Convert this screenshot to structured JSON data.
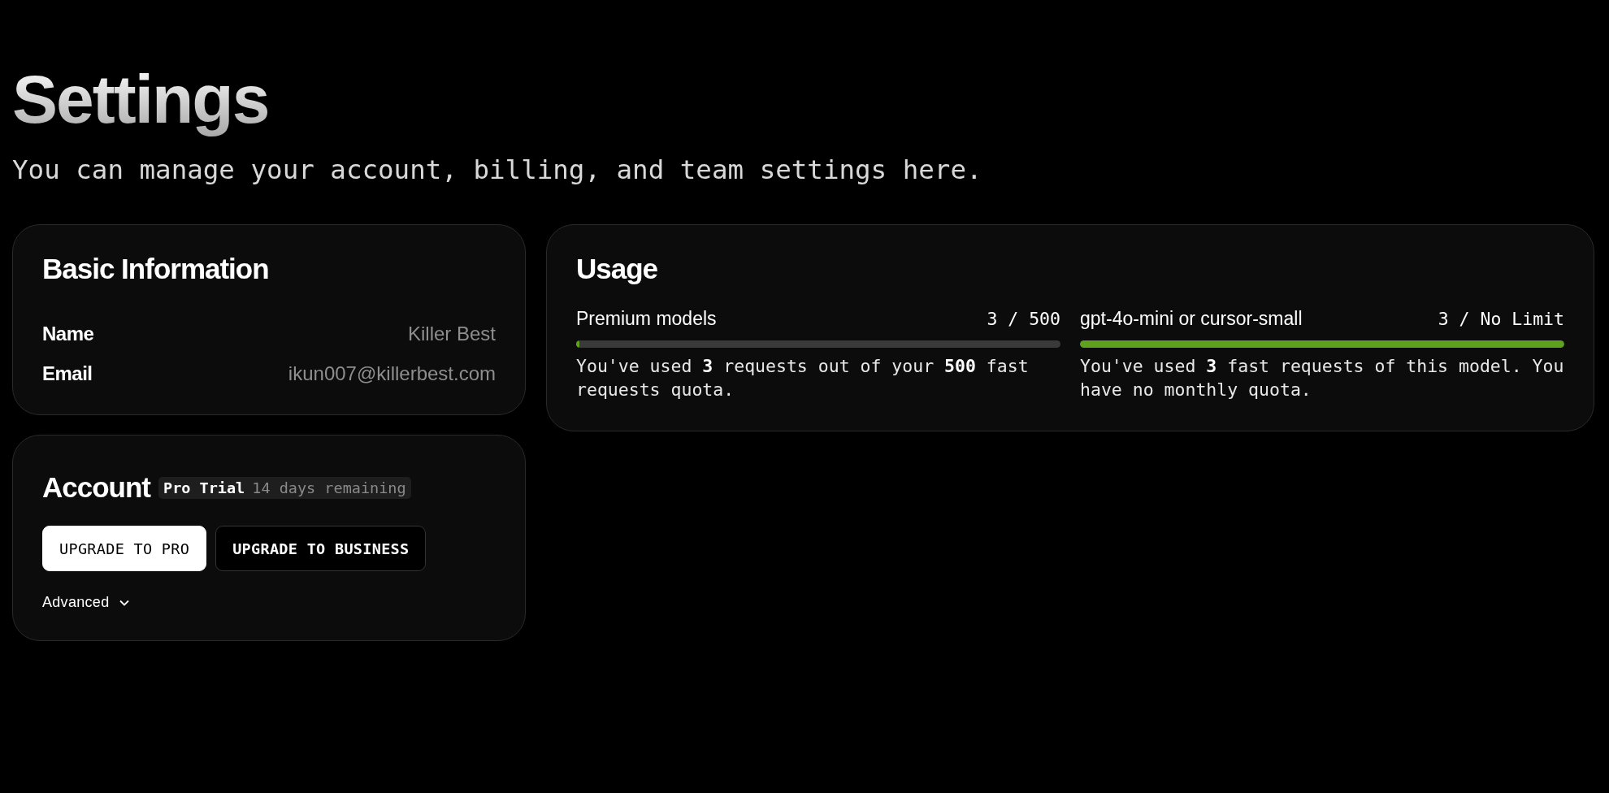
{
  "page": {
    "title": "Settings",
    "subtitle": "You can manage your account, billing, and team settings here."
  },
  "basic_information": {
    "title": "Basic Information",
    "rows": [
      {
        "label": "Name",
        "value": "Killer Best"
      },
      {
        "label": "Email",
        "value": "ikun007@killerbest.com"
      }
    ]
  },
  "account": {
    "title": "Account",
    "badge": {
      "plan": "Pro Trial",
      "detail": "14 days remaining"
    },
    "buttons": [
      {
        "label": "UPGRADE TO PRO",
        "kind": "primary"
      },
      {
        "label": "UPGRADE TO BUSINESS",
        "kind": "secondary"
      }
    ],
    "advanced": {
      "label": "Advanced",
      "expanded": false
    }
  },
  "usage": {
    "title": "Usage",
    "meters": [
      {
        "label": "Premium models",
        "reading": "3 / 500",
        "level": 0.006,
        "description": "You've used **3** requests out of your **500** fast requests quota."
      },
      {
        "label": "gpt-4o-mini or cursor-small",
        "reading": "3 / No Limit",
        "level": 1,
        "description": "You've used **3** fast requests of this model. You have no monthly quota."
      }
    ]
  }
}
